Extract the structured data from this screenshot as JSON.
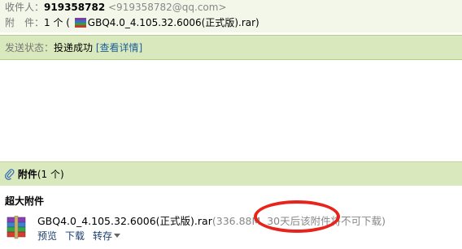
{
  "recipient": {
    "label": "收件人：",
    "name": "919358782",
    "email": "<919358782@qq.com>"
  },
  "attachment_line": {
    "label": "附　件：",
    "count": "1 个 (",
    "filename": "GBQ4.0_4.105.32.6006(正式版).rar)"
  },
  "status": {
    "label": "发送状态：",
    "value": "投递成功",
    "details_link": "[查看详情]"
  },
  "attachments_header": {
    "title": "附件",
    "count": "(1 个)"
  },
  "super_attachment": {
    "title": "超大附件",
    "filename": "GBQ4.0_4.105.32.6006(正式版).rar",
    "meta": "(336.88M, 30天后该附件将不可下载)",
    "actions": {
      "preview": "预览",
      "download": "下载",
      "save": "转存"
    }
  },
  "colors": {
    "header_bg": "#f3f7ea",
    "bar_bg": "#d9e9bd",
    "highlight": "#e8231c"
  }
}
